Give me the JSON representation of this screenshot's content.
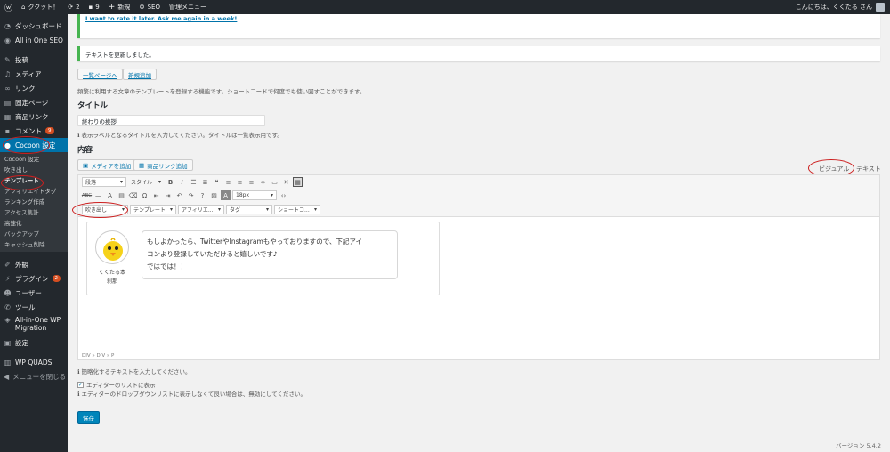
{
  "adminbar": {
    "site_name": "ククット！",
    "updates": "2",
    "comments": "9",
    "new_label": "新規",
    "seo_label": "SEO",
    "admin_menu": "管理メニュー",
    "greeting": "こんにちは、くくたる さん"
  },
  "sidebar": {
    "items": [
      {
        "label": "ダッシュボード",
        "icon": "dashboard-icon"
      },
      {
        "label": "All in One SEO",
        "icon": "seo-icon"
      },
      {
        "label": "投稿",
        "icon": "pin-icon"
      },
      {
        "label": "メディア",
        "icon": "media-icon"
      },
      {
        "label": "リンク",
        "icon": "link-icon"
      },
      {
        "label": "固定ページ",
        "icon": "page-icon"
      },
      {
        "label": "商品リンク",
        "icon": "cart-icon"
      },
      {
        "label": "コメント",
        "icon": "comment-icon",
        "badge": "9"
      },
      {
        "label": "Cocoon 設定",
        "icon": "cocoon-icon"
      }
    ],
    "submenu": [
      "Cocoon 設定",
      "吹き出し",
      "テンプレート",
      "アフィリエイトタグ",
      "ランキング作成",
      "アクセス集計",
      "高速化",
      "バックアップ",
      "キャッシュ削除"
    ],
    "items2": [
      {
        "label": "外観",
        "icon": "brush-icon"
      },
      {
        "label": "プラグイン",
        "icon": "plugin-icon",
        "badge": "2"
      },
      {
        "label": "ユーザー",
        "icon": "user-icon"
      },
      {
        "label": "ツール",
        "icon": "wrench-icon"
      },
      {
        "label": "All-in-One WP Migration",
        "icon": "migration-icon"
      },
      {
        "label": "設定",
        "icon": "settings-icon"
      },
      {
        "label": "WP QUADS",
        "icon": "quads-icon"
      },
      {
        "label": "メニューを閉じる",
        "icon": "collapse-icon"
      }
    ]
  },
  "notices": {
    "rate_link": "I want to rate it later. Ask me again in a week!",
    "updated": "テキストを更新しました。"
  },
  "actions": {
    "back_to_list": "一覧ページへ",
    "add_new": "新規追加"
  },
  "description": "頻繁に利用する文章のテンプレートを登録する機能です。ショートコードで何度でも使い回すことができます。",
  "title_section": {
    "heading": "タイトル",
    "value": "終わりの挨拶",
    "help": "表示ラベルとなるタイトルを入力してください。タイトルは一覧表示用です。"
  },
  "content_section": {
    "heading": "内容",
    "add_media": "メディアを追加",
    "add_product_link": "商品リンク追加",
    "tab_visual": "ビジュアル",
    "tab_text": "テキスト"
  },
  "toolbar": {
    "paragraph": "段落",
    "style": "スタイル",
    "font_size": "18px",
    "balloon": "吹き出し",
    "template": "テンプレート",
    "affiliate": "アフィリエ...",
    "tag": "タグ",
    "shortcode": "ショートコ..."
  },
  "balloon": {
    "name_line1": "くくたる本",
    "name_line2": "刹那",
    "line1": "もしよかったら、TwitterやInstagramもやっておりますので、下記アイ",
    "line2": "コンより登録していただけると嬉しいです♪",
    "line3": "ではでは！！"
  },
  "editor": {
    "path": "DIV » DIV » P",
    "help": "簡略化するテキストを入力してください。"
  },
  "options": {
    "show_in_list": "エディターのリストに表示",
    "show_help": "エディターのドロップダウンリストに表示しなくて良い場合は、無効にしてください。"
  },
  "save_label": "保存",
  "version": "バージョン 5.4.2",
  "colors": {
    "admin_dark": "#23282d",
    "accent_blue": "#0073aa",
    "primary_button": "#0085ba",
    "annotation_red": "#cc1f1f",
    "notice_green": "#46b450"
  }
}
